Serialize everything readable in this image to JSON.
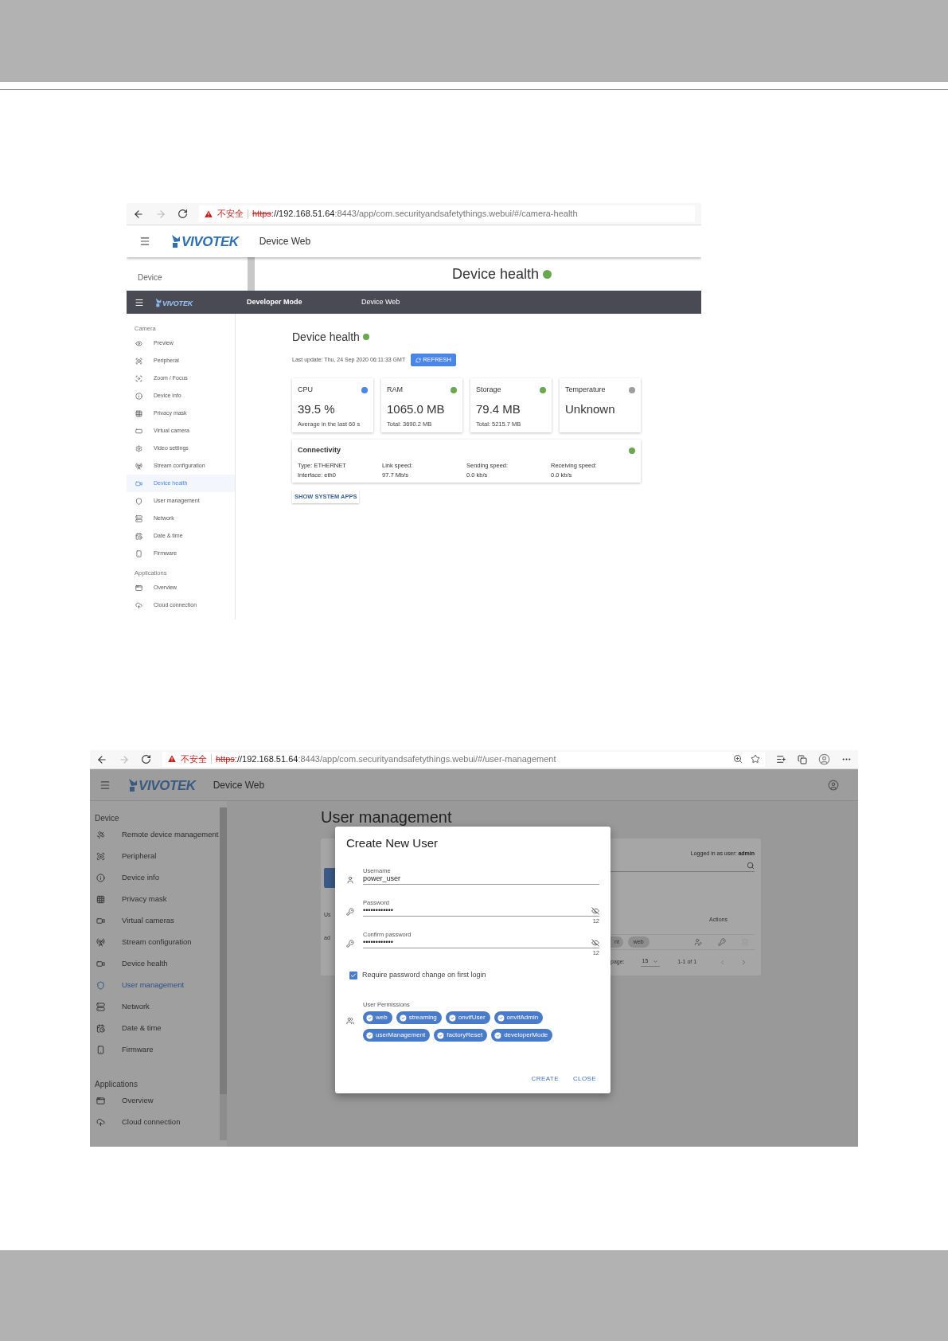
{
  "screenshot_1": {
    "browser": {
      "warning": "不安全",
      "scheme": "https",
      "host": "://192.168.51.64",
      "path": ":8443/app/com.securityandsafetythings.webui/#/camera-health"
    },
    "header": {
      "logo": "VIVOTEK",
      "title": "Device Web"
    },
    "behind": {
      "sidebar_heading": "Device",
      "page_title": "Device health",
      "color": "#6aa84f"
    },
    "dev_bar": {
      "logo": "VIVOTEK",
      "mode": "Developer Mode",
      "title": "Device Web"
    },
    "sidebar": [
      {
        "heading": "Camera",
        "items": [
          {
            "label": "Preview",
            "selected": false
          },
          {
            "label": "Peripheral",
            "selected": false
          },
          {
            "label": "Zoom / Focus",
            "selected": false
          },
          {
            "label": "Device info",
            "selected": false
          },
          {
            "label": "Privacy mask",
            "selected": false
          },
          {
            "label": "Virtual camera",
            "selected": false
          },
          {
            "label": "Video settings",
            "selected": false
          },
          {
            "label": "Stream configuration",
            "selected": false
          },
          {
            "label": "Device health",
            "selected": true
          },
          {
            "label": "User management",
            "selected": false
          },
          {
            "label": "Network",
            "selected": false
          },
          {
            "label": "Date & time",
            "selected": false
          },
          {
            "label": "Firmware",
            "selected": false
          }
        ]
      },
      {
        "heading": "Applications",
        "items": [
          {
            "label": "Overview",
            "selected": false
          },
          {
            "label": "Cloud connection",
            "selected": false
          }
        ]
      }
    ],
    "page_title": "Device health",
    "color": "#6aa84f",
    "last_update": "Last update: Thu, 24 Sep 2020 06:11:33 GMT",
    "refresh": "REFRESH",
    "cards": [
      {
        "title": "CPU",
        "value": "39.5 %",
        "note": "Average in the last 60 s",
        "color": "#4a86e8"
      },
      {
        "title": "RAM",
        "value": "1065.0 MB",
        "note": "Total: 3690.2 MB",
        "color": "#6aa84f"
      },
      {
        "title": "Storage",
        "value": "79.4 MB",
        "note": "Total: 5215.7 MB",
        "color": "#6aa84f"
      },
      {
        "title": "Temperature",
        "value": "Unknown",
        "color": "#9e9e9e"
      }
    ],
    "connectivity": {
      "title": "Connectivity",
      "color": "#6aa84f",
      "columns": [
        [
          "Type: ETHERNET",
          "Interface: eth0"
        ],
        [
          "Link speed:",
          "97.7 Mb/s"
        ],
        [
          "Sending speed:",
          "0.0 kb/s"
        ],
        [
          "Receiving speed:",
          "0.0 kb/s"
        ]
      ]
    },
    "show_system_apps": "SHOW SYSTEM APPS"
  },
  "screenshot_2": {
    "browser": {
      "warning": "不安全",
      "scheme": "https",
      "host": "://192.168.51.64",
      "path": ":8443/app/com.securityandsafetythings.webui/#/user-management"
    },
    "header": {
      "logo": "VIVOTEK",
      "title": "Device Web"
    },
    "sidebar": [
      {
        "heading": "Device",
        "items": [
          {
            "label": "Remote device management",
            "selected": false
          },
          {
            "label": "Peripheral",
            "selected": false
          },
          {
            "label": "Device info",
            "selected": false
          },
          {
            "label": "Privacy mask",
            "selected": false
          },
          {
            "label": "Virtual cameras",
            "selected": false
          },
          {
            "label": "Stream configuration",
            "selected": false
          },
          {
            "label": "Device health",
            "selected": false
          },
          {
            "label": "User management",
            "selected": true
          },
          {
            "label": "Network",
            "selected": false
          },
          {
            "label": "Date & time",
            "selected": false
          },
          {
            "label": "Firmware",
            "selected": false
          }
        ]
      },
      {
        "heading": "Applications",
        "items": [
          {
            "label": "Overview",
            "selected": false
          },
          {
            "label": "Cloud connection",
            "selected": false
          }
        ]
      }
    ],
    "page_title": "User management",
    "table": {
      "logged_in": "Logged in as user: **admin**",
      "column_1": "Us",
      "actions": "Actions",
      "cell_1": "ad",
      "chips": [
        "nt",
        "web"
      ],
      "rows_per_page_label": "page:",
      "rows_per_page": "15",
      "range": "1-1 of 1"
    },
    "dialog": {
      "title": "Create New User",
      "fields": [
        {
          "label": "Username",
          "value": "power_user",
          "kind": "text"
        },
        {
          "label": "Password",
          "value": "••••••••••••",
          "kind": "password",
          "counter": "12"
        },
        {
          "label": "Confirm password",
          "value": "••••••••••••",
          "kind": "password",
          "counter": "12"
        }
      ],
      "require_change": {
        "label": "Require password change on first login",
        "checked": true
      },
      "permissions_label": "User Permissions",
      "permissions": [
        {
          "label": "web",
          "selected": true
        },
        {
          "label": "streaming",
          "selected": true
        },
        {
          "label": "onvifUser",
          "selected": true
        },
        {
          "label": "onvifAdmin",
          "selected": true
        },
        {
          "label": "userManagement",
          "selected": true
        },
        {
          "label": "factoryReset",
          "selected": true
        },
        {
          "label": "developerMode",
          "selected": true
        }
      ],
      "buttons": [
        "CREATE",
        "CLOSE"
      ]
    }
  }
}
